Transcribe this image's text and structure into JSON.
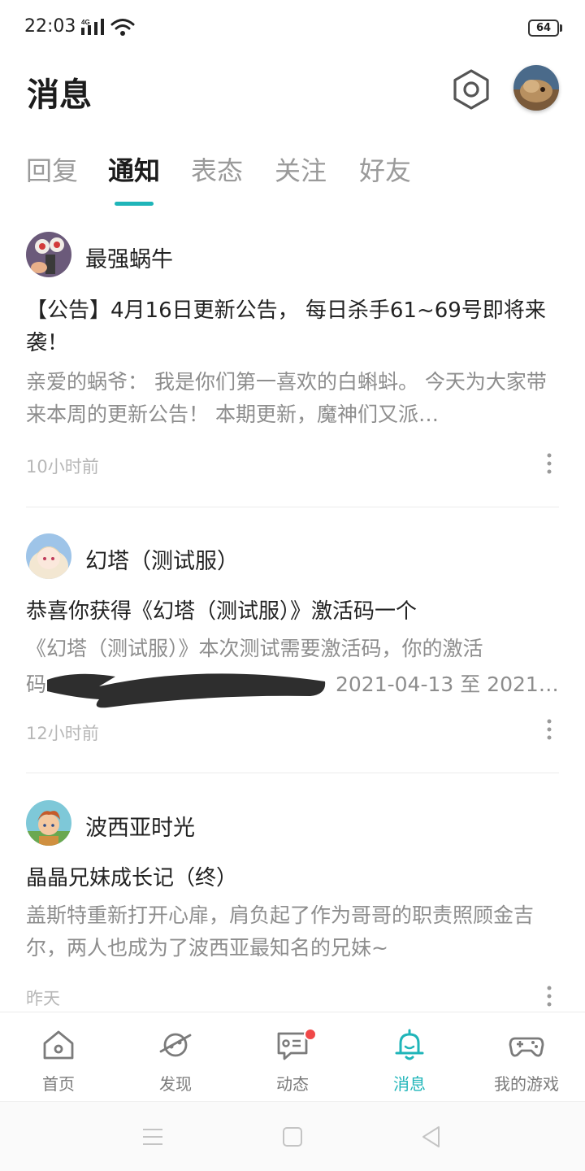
{
  "status_bar": {
    "time": "22:03",
    "network": "4G",
    "battery": "64"
  },
  "header": {
    "title": "消息",
    "settings_icon": "hexagon-gear-icon",
    "avatar_icon": "user-avatar"
  },
  "tabs": [
    {
      "label": "回复",
      "active": false
    },
    {
      "label": "通知",
      "active": true
    },
    {
      "label": "表态",
      "active": false
    },
    {
      "label": "关注",
      "active": false
    },
    {
      "label": "好友",
      "active": false
    }
  ],
  "messages": [
    {
      "sender": "最强蜗牛",
      "title": "【公告】4月16日更新公告， 每日杀手61~69号即将来袭！",
      "body": "亲爱的蜗爷： 我是你们第一喜欢的白蝌蚪。 今天为大家带来本周的更新公告！ 本期更新，魔神们又派…",
      "time": "10小时前"
    },
    {
      "sender": "幻塔（测试服）",
      "title": "恭喜你获得《幻塔（测试服）》激活码一个",
      "body_line1": "《幻塔（测试服）》本次测试需要激活码，你的激活",
      "body_line2_prefix": "码",
      "body_line2_suffix": "2021-04-13 至 2021…",
      "time": "12小时前"
    },
    {
      "sender": "波西亚时光",
      "title": "晶晶兄妹成长记（终）",
      "body": "盖斯特重新打开心扉，肩负起了作为哥哥的职责照顾金吉尔，两人也成为了波西亚最知名的兄妹~",
      "time": "昨天"
    }
  ],
  "bottom_nav": [
    {
      "label": "首页",
      "icon": "home-icon",
      "active": false
    },
    {
      "label": "发现",
      "icon": "planet-icon",
      "active": false
    },
    {
      "label": "动态",
      "icon": "feed-chat-icon",
      "active": false,
      "badge": true
    },
    {
      "label": "消息",
      "icon": "bell-icon",
      "active": true
    },
    {
      "label": "我的游戏",
      "icon": "gamepad-icon",
      "active": false
    }
  ],
  "colors": {
    "accent": "#1fb5b9",
    "badge": "#f04848",
    "muted_text": "#8d8d8d",
    "time_text": "#b7b7b7"
  }
}
